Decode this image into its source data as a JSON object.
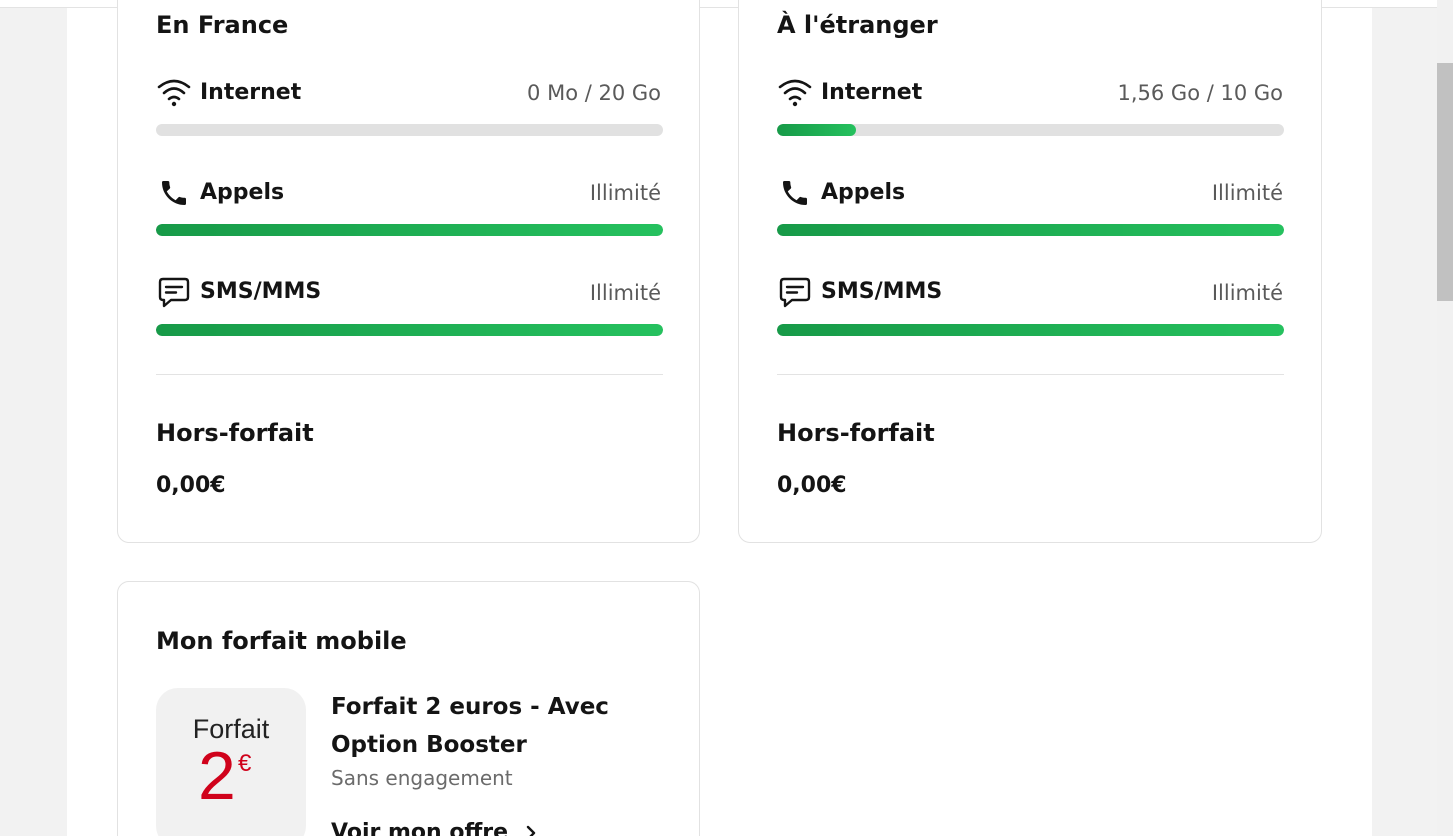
{
  "france": {
    "title": "En France",
    "internet": {
      "label": "Internet",
      "value": "0 Mo / 20 Go",
      "fill": 0
    },
    "calls": {
      "label": "Appels",
      "value": "Illimité",
      "fill": 1
    },
    "sms": {
      "label": "SMS/MMS",
      "value": "Illimité",
      "fill": 1
    },
    "extra_title": "Hors-forfait",
    "extra_amount": "0,00€"
  },
  "abroad": {
    "title": "À l'étranger",
    "internet": {
      "label": "Internet",
      "value": "1,56 Go / 10 Go",
      "fill": 0.156
    },
    "calls": {
      "label": "Appels",
      "value": "Illimité",
      "fill": 1
    },
    "sms": {
      "label": "SMS/MMS",
      "value": "Illimité",
      "fill": 1
    },
    "extra_title": "Hors-forfait",
    "extra_amount": "0,00€"
  },
  "plan": {
    "section_title": "Mon forfait mobile",
    "logo_word": "Forfait",
    "logo_price": "2",
    "logo_currency": "€",
    "name": "Forfait 2 euros - Avec Option Booster",
    "commitment": "Sans engagement",
    "link_label": "Voir mon offre"
  },
  "colors": {
    "accent_green": "#1fae55",
    "brand_red": "#d0021b",
    "track_grey": "#e1e1e1"
  },
  "icons": {
    "internet": "wifi-icon",
    "calls": "phone-icon",
    "sms": "message-icon",
    "link": "chevron-right-icon"
  }
}
